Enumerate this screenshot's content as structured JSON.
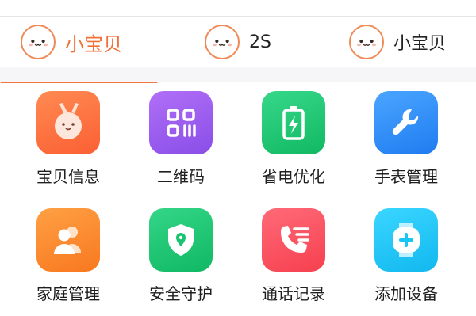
{
  "tabs": [
    {
      "label": "小宝贝",
      "active": true,
      "avatar_icon": "baby-face-icon"
    },
    {
      "label": "2S",
      "active": false,
      "avatar_icon": "baby-face-icon"
    },
    {
      "label": "小宝贝",
      "active": false,
      "avatar_icon": "baby-face-icon"
    }
  ],
  "accent_color": "#f2753d",
  "grid_items": [
    {
      "label": "宝贝信息",
      "icon": "bunny-face-icon",
      "color": "#fb6f3e"
    },
    {
      "label": "二维码",
      "icon": "qr-code-icon",
      "color": "#9a5cf0"
    },
    {
      "label": "省电优化",
      "icon": "battery-charging-icon",
      "color": "#1fc86f"
    },
    {
      "label": "手表管理",
      "icon": "wrench-icon",
      "color": "#2f8bf5"
    },
    {
      "label": "家庭管理",
      "icon": "family-icon",
      "color": "#fc8a2c"
    },
    {
      "label": "安全守护",
      "icon": "shield-icon",
      "color": "#19c470"
    },
    {
      "label": "通话记录",
      "icon": "phone-list-icon",
      "color": "#fb4f63"
    },
    {
      "label": "添加设备",
      "icon": "add-watch-icon",
      "color": "#16c6f5"
    }
  ]
}
